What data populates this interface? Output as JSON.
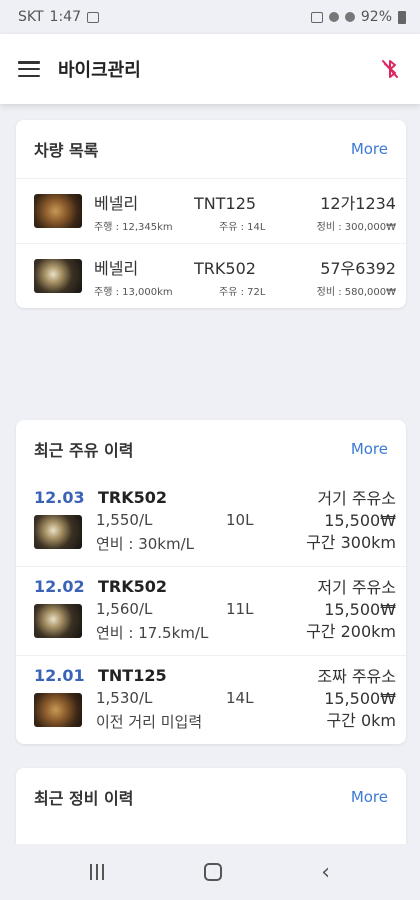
{
  "status_bar": {
    "carrier": "SKT",
    "time": "1:47",
    "battery": "92%"
  },
  "app_bar": {
    "title": "바이크관리"
  },
  "vehicles": {
    "title": "차량 목록",
    "more": "More",
    "items": [
      {
        "name": "베넬리",
        "model": "TNT125",
        "plate": "12가1234",
        "mileage": "주행 : 12,345km",
        "fuel": "주유 : 14L",
        "maintenance": "정비 : 300,000₩"
      },
      {
        "name": "베넬리",
        "model": "TRK502",
        "plate": "57우6392",
        "mileage": "주행 : 13,000km",
        "fuel": "주유 : 72L",
        "maintenance": "정비 : 580,000₩"
      }
    ]
  },
  "fuel_history": {
    "title": "최근 주유 이력",
    "more": "More",
    "items": [
      {
        "date": "12.03",
        "model": "TRK502",
        "price": "1,550/L",
        "liters": "10L",
        "efficiency": "연비 : 30km/L",
        "station": "거기 주유소",
        "cost": "15,500₩",
        "distance": "구간 300km"
      },
      {
        "date": "12.02",
        "model": "TRK502",
        "price": "1,560/L",
        "liters": "11L",
        "efficiency": "연비 : 17.5km/L",
        "station": "저기 주유소",
        "cost": "15,500₩",
        "distance": "구간 200km"
      },
      {
        "date": "12.01",
        "model": "TNT125",
        "price": "1,530/L",
        "liters": "14L",
        "efficiency": "이전 거리 미입력",
        "station": "조짜 주유소",
        "cost": "15,500₩",
        "distance": "구간 0km"
      }
    ]
  },
  "maintenance_history": {
    "title": "최근 정비 이력",
    "more": "More"
  },
  "colors": {
    "accent": "#3b7bd6",
    "date": "#3a63b8",
    "bluetooth_off": "#e0245e"
  }
}
